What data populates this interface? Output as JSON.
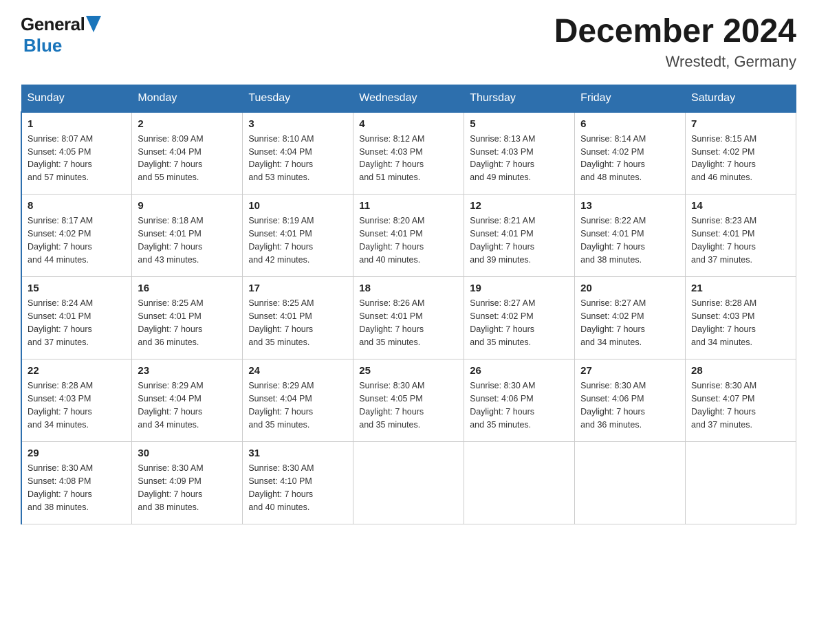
{
  "header": {
    "title": "December 2024",
    "subtitle": "Wrestedt, Germany"
  },
  "logo": {
    "part1": "General",
    "part2": "Blue"
  },
  "days_of_week": [
    "Sunday",
    "Monday",
    "Tuesday",
    "Wednesday",
    "Thursday",
    "Friday",
    "Saturday"
  ],
  "weeks": [
    [
      {
        "num": "1",
        "info": "Sunrise: 8:07 AM\nSunset: 4:05 PM\nDaylight: 7 hours\nand 57 minutes."
      },
      {
        "num": "2",
        "info": "Sunrise: 8:09 AM\nSunset: 4:04 PM\nDaylight: 7 hours\nand 55 minutes."
      },
      {
        "num": "3",
        "info": "Sunrise: 8:10 AM\nSunset: 4:04 PM\nDaylight: 7 hours\nand 53 minutes."
      },
      {
        "num": "4",
        "info": "Sunrise: 8:12 AM\nSunset: 4:03 PM\nDaylight: 7 hours\nand 51 minutes."
      },
      {
        "num": "5",
        "info": "Sunrise: 8:13 AM\nSunset: 4:03 PM\nDaylight: 7 hours\nand 49 minutes."
      },
      {
        "num": "6",
        "info": "Sunrise: 8:14 AM\nSunset: 4:02 PM\nDaylight: 7 hours\nand 48 minutes."
      },
      {
        "num": "7",
        "info": "Sunrise: 8:15 AM\nSunset: 4:02 PM\nDaylight: 7 hours\nand 46 minutes."
      }
    ],
    [
      {
        "num": "8",
        "info": "Sunrise: 8:17 AM\nSunset: 4:02 PM\nDaylight: 7 hours\nand 44 minutes."
      },
      {
        "num": "9",
        "info": "Sunrise: 8:18 AM\nSunset: 4:01 PM\nDaylight: 7 hours\nand 43 minutes."
      },
      {
        "num": "10",
        "info": "Sunrise: 8:19 AM\nSunset: 4:01 PM\nDaylight: 7 hours\nand 42 minutes."
      },
      {
        "num": "11",
        "info": "Sunrise: 8:20 AM\nSunset: 4:01 PM\nDaylight: 7 hours\nand 40 minutes."
      },
      {
        "num": "12",
        "info": "Sunrise: 8:21 AM\nSunset: 4:01 PM\nDaylight: 7 hours\nand 39 minutes."
      },
      {
        "num": "13",
        "info": "Sunrise: 8:22 AM\nSunset: 4:01 PM\nDaylight: 7 hours\nand 38 minutes."
      },
      {
        "num": "14",
        "info": "Sunrise: 8:23 AM\nSunset: 4:01 PM\nDaylight: 7 hours\nand 37 minutes."
      }
    ],
    [
      {
        "num": "15",
        "info": "Sunrise: 8:24 AM\nSunset: 4:01 PM\nDaylight: 7 hours\nand 37 minutes."
      },
      {
        "num": "16",
        "info": "Sunrise: 8:25 AM\nSunset: 4:01 PM\nDaylight: 7 hours\nand 36 minutes."
      },
      {
        "num": "17",
        "info": "Sunrise: 8:25 AM\nSunset: 4:01 PM\nDaylight: 7 hours\nand 35 minutes."
      },
      {
        "num": "18",
        "info": "Sunrise: 8:26 AM\nSunset: 4:01 PM\nDaylight: 7 hours\nand 35 minutes."
      },
      {
        "num": "19",
        "info": "Sunrise: 8:27 AM\nSunset: 4:02 PM\nDaylight: 7 hours\nand 35 minutes."
      },
      {
        "num": "20",
        "info": "Sunrise: 8:27 AM\nSunset: 4:02 PM\nDaylight: 7 hours\nand 34 minutes."
      },
      {
        "num": "21",
        "info": "Sunrise: 8:28 AM\nSunset: 4:03 PM\nDaylight: 7 hours\nand 34 minutes."
      }
    ],
    [
      {
        "num": "22",
        "info": "Sunrise: 8:28 AM\nSunset: 4:03 PM\nDaylight: 7 hours\nand 34 minutes."
      },
      {
        "num": "23",
        "info": "Sunrise: 8:29 AM\nSunset: 4:04 PM\nDaylight: 7 hours\nand 34 minutes."
      },
      {
        "num": "24",
        "info": "Sunrise: 8:29 AM\nSunset: 4:04 PM\nDaylight: 7 hours\nand 35 minutes."
      },
      {
        "num": "25",
        "info": "Sunrise: 8:30 AM\nSunset: 4:05 PM\nDaylight: 7 hours\nand 35 minutes."
      },
      {
        "num": "26",
        "info": "Sunrise: 8:30 AM\nSunset: 4:06 PM\nDaylight: 7 hours\nand 35 minutes."
      },
      {
        "num": "27",
        "info": "Sunrise: 8:30 AM\nSunset: 4:06 PM\nDaylight: 7 hours\nand 36 minutes."
      },
      {
        "num": "28",
        "info": "Sunrise: 8:30 AM\nSunset: 4:07 PM\nDaylight: 7 hours\nand 37 minutes."
      }
    ],
    [
      {
        "num": "29",
        "info": "Sunrise: 8:30 AM\nSunset: 4:08 PM\nDaylight: 7 hours\nand 38 minutes."
      },
      {
        "num": "30",
        "info": "Sunrise: 8:30 AM\nSunset: 4:09 PM\nDaylight: 7 hours\nand 38 minutes."
      },
      {
        "num": "31",
        "info": "Sunrise: 8:30 AM\nSunset: 4:10 PM\nDaylight: 7 hours\nand 40 minutes."
      },
      {
        "num": "",
        "info": ""
      },
      {
        "num": "",
        "info": ""
      },
      {
        "num": "",
        "info": ""
      },
      {
        "num": "",
        "info": ""
      }
    ]
  ]
}
